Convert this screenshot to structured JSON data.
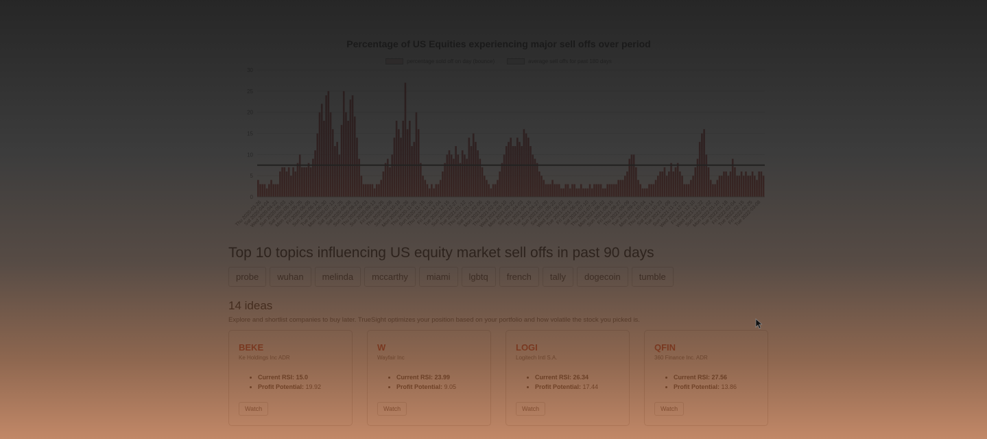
{
  "chart_data": {
    "type": "bar",
    "title": "Percentage of US Equities experiencing major sell offs over period",
    "legend": [
      {
        "label": "percentage sold off on day (bounce)",
        "color": "#8b2c2c"
      },
      {
        "label": "average sell offs for past 180 days",
        "color": "#333333"
      }
    ],
    "ylim": [
      0,
      30
    ],
    "yticks": [
      0,
      5,
      10,
      15,
      20,
      25,
      30
    ],
    "grid": true,
    "average_line": 7.5,
    "values": [
      4,
      3,
      3,
      3,
      2,
      3,
      4,
      3,
      3,
      3,
      6,
      7,
      7,
      6,
      7,
      5,
      7,
      6,
      8,
      10,
      7,
      7,
      7,
      8,
      7,
      9,
      11,
      15,
      20,
      22,
      18,
      24,
      25,
      20,
      16,
      12,
      13,
      10,
      17,
      25,
      20,
      18,
      23,
      24,
      19,
      14,
      9,
      5,
      3,
      3,
      3,
      3,
      3,
      2,
      3,
      3,
      4,
      6,
      8,
      9,
      7,
      10,
      14,
      18,
      16,
      14,
      18,
      27,
      16,
      18,
      12,
      13,
      20,
      16,
      8,
      5,
      4,
      3,
      2,
      3,
      2,
      3,
      3,
      4,
      6,
      8,
      10,
      11,
      10,
      9,
      12,
      10,
      8,
      11,
      10,
      9,
      14,
      12,
      15,
      13,
      11,
      9,
      7,
      5,
      4,
      3,
      2,
      3,
      3,
      4,
      6,
      8,
      10,
      12,
      13,
      14,
      12,
      12,
      14,
      13,
      12,
      16,
      15,
      14,
      12,
      10,
      9,
      8,
      6,
      5,
      4,
      3,
      3,
      3,
      4,
      3,
      3,
      3,
      2,
      2,
      3,
      3,
      2,
      3,
      3,
      2,
      2,
      3,
      2,
      2,
      2,
      3,
      2,
      3,
      3,
      3,
      3,
      2,
      2,
      3,
      3,
      3,
      3,
      3,
      4,
      4,
      4,
      5,
      6,
      9,
      10,
      10,
      7,
      4,
      3,
      2,
      2,
      2,
      3,
      3,
      3,
      4,
      5,
      6,
      6,
      7,
      5,
      6,
      8,
      6,
      7,
      8,
      6,
      5,
      3,
      3,
      3,
      4,
      5,
      7,
      9,
      13,
      15,
      16,
      10,
      7,
      4,
      3,
      3,
      4,
      5,
      5,
      6,
      6,
      5,
      6,
      9,
      7,
      5,
      5,
      6,
      5,
      6,
      5,
      5,
      6,
      5,
      4,
      6,
      6,
      5
    ],
    "xtick_labels": [
      "Thu 2020-03-26",
      "Sat 2020-04-04",
      "Wed 2020-04-22",
      "Sun 2020-05-03",
      "Sat 2020-05-16",
      "Mon 2020-05-25",
      "Fri 2020-06-05",
      "Sun 2020-06-14",
      "Tue 2020-06-30",
      "Mon 2020-07-13",
      "Sat 2020-07-25",
      "Sat 2020-08-08",
      "Sun 2020-08-23",
      "Thu 2020-09-03",
      "Sun 2020-09-13",
      "Fri 2020-09-25",
      "Thu 2020-10-08",
      "Sun 2020-10-18",
      "Mon 2020-10-26",
      "Thu 2020-11-05",
      "Sun 2020-11-15",
      "Thu 2020-11-26",
      "Fri 2020-12-04",
      "Tue 2020-12-15",
      "Sun 2020-12-27",
      "Tue 2021-01-12",
      "Thu 2021-01-21",
      "Sat 2021-02-06",
      "Mon 2021-02-15",
      "Thu 2021-02-25",
      "Wed 2021-03-10",
      "Mon 2021-03-22",
      "Sat 2021-04-03",
      "Thu 2021-04-15",
      "Tue 2021-04-27",
      "Sun 2021-05-09",
      "Sat 2021-05-22",
      "Wed 2021-06-02",
      "Tue 2021-06-15",
      "Fri 2021-06-25",
      "Sat 2021-07-10",
      "Thu 2021-07-22",
      "Mon 2021-08-02",
      "Sun 2021-08-15",
      "Fri 2021-08-27",
      "Thu 2021-09-09",
      "Tue 2021-09-21",
      "Mon 2021-10-04",
      "Thu 2021-10-14",
      "Sat 2021-10-23",
      "Tue 2021-11-09",
      "Sun 2021-11-21",
      "Wed 2021-12-01",
      "Fri 2021-12-10",
      "Wed 2021-12-22",
      "Sun 2022-01-02",
      "Mon 2022-01-10",
      "Tue 2022-01-18",
      "Fri 2022-02-04",
      "Tue 2022-02-15",
      "Fri 2022-02-25",
      "Tue 2022-03-08"
    ]
  },
  "topics": {
    "heading": "Top 10 topics influencing US equity market sell offs in past 90 days",
    "items": [
      "probe",
      "wuhan",
      "melinda",
      "mccarthy",
      "miami",
      "lgbtq",
      "french",
      "tally",
      "dogecoin",
      "tumble"
    ]
  },
  "ideas": {
    "heading": "14 ideas",
    "description": "Explore and shortlist companies to buy later. TrueSight optimizes your position based on your portfolio and how volatile the stock you picked is.",
    "rsi_label": "Current RSI:",
    "profit_label": "Profit Potential:",
    "watch_label": "Watch",
    "cards": [
      {
        "ticker": "BEKE",
        "name": "Ke Holdings Inc ADR",
        "rsi": "15.0",
        "profit": "19.92"
      },
      {
        "ticker": "W",
        "name": "Wayfair Inc",
        "rsi": "23.99",
        "profit": "9.05"
      },
      {
        "ticker": "LOGI",
        "name": "Logitech Intl S.A.",
        "rsi": "26.34",
        "profit": "17.44"
      },
      {
        "ticker": "QFIN",
        "name": "360 Finance Inc. ADR",
        "rsi": "27.56",
        "profit": "13.86"
      }
    ]
  }
}
